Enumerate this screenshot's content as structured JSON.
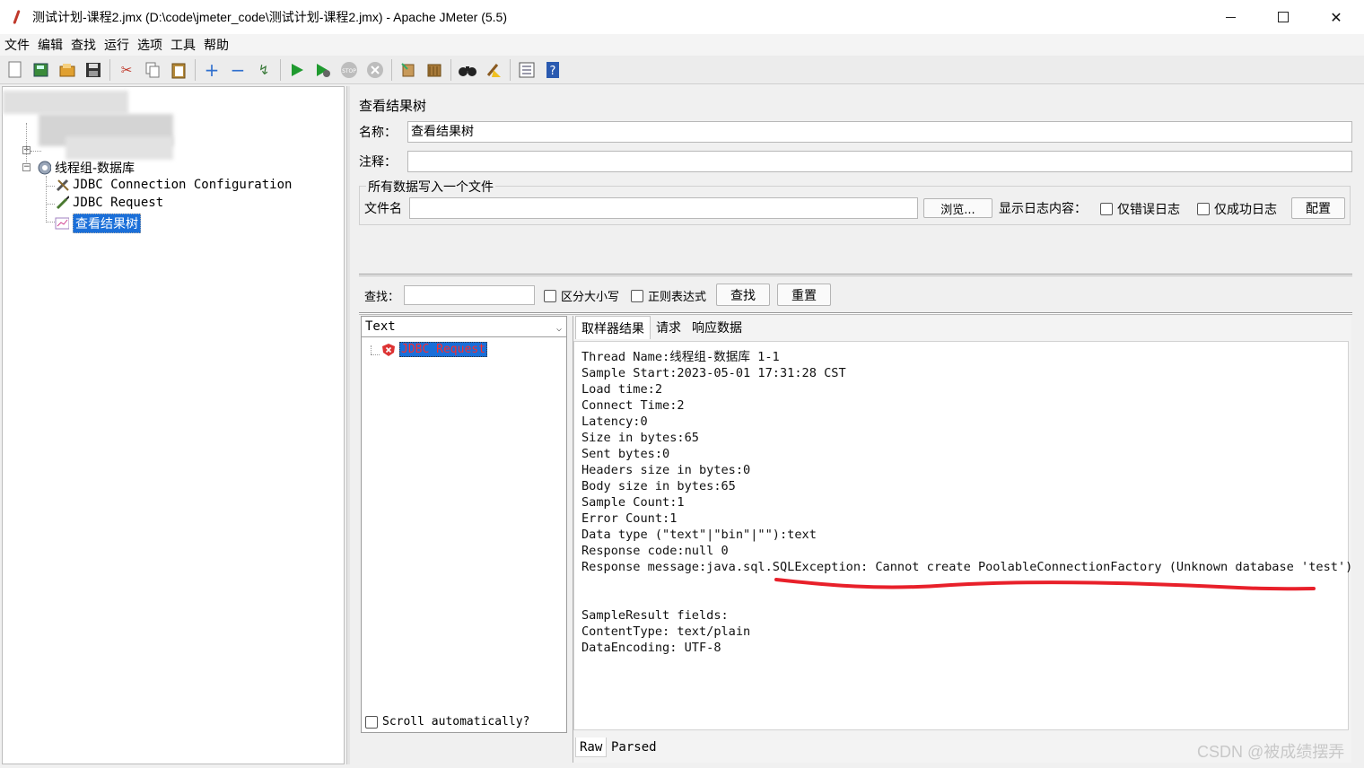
{
  "window": {
    "title": "测试计划-课程2.jmx (D:\\code\\jmeter_code\\测试计划-课程2.jmx) - Apache JMeter (5.5)"
  },
  "menu": [
    "文件",
    "编辑",
    "查找",
    "运行",
    "选项",
    "工具",
    "帮助"
  ],
  "toolbar": {
    "icons": [
      "new-icon",
      "templates-icon",
      "open-icon",
      "save-icon",
      "cut-icon",
      "copy-icon",
      "paste-icon",
      "expand-icon",
      "collapse-icon",
      "toggle-icon",
      "start-icon",
      "start-no-pauses-icon",
      "stop-icon",
      "shutdown-icon",
      "clear-icon",
      "clear-all-icon",
      "search-icon",
      "reset-search-icon",
      "function-helper-icon",
      "help-icon"
    ]
  },
  "tree": {
    "thread_group": "线程组-数据库",
    "items": [
      {
        "label": "JDBC Connection Configuration",
        "icon": "wrench-icon"
      },
      {
        "label": "JDBC Request",
        "icon": "pen-icon"
      },
      {
        "label": "查看结果树",
        "icon": "chart-icon",
        "selected": true
      }
    ]
  },
  "panel": {
    "heading": "查看结果树",
    "name_label": "名称：",
    "name_value": "查看结果树",
    "comment_label": "注释：",
    "comment_value": "",
    "file_group_title": "所有数据写入一个文件",
    "filename_label": "文件名",
    "filename_value": "",
    "browse_button": "浏览...",
    "log_display_label": "显示日志内容：",
    "errors_only": "仅错误日志",
    "success_only": "仅成功日志",
    "configure_button": "配置"
  },
  "search": {
    "label": "查找：",
    "value": "",
    "case_sensitive": "区分大小写",
    "regex": "正则表达式",
    "find_button": "查找",
    "reset_button": "重置"
  },
  "results": {
    "renderer": "Text",
    "samples": [
      {
        "label": "JDBC Request",
        "status": "error"
      }
    ],
    "scroll_auto": "Scroll automatically?"
  },
  "detail": {
    "tabs": [
      "取样器结果",
      "请求",
      "响应数据"
    ],
    "active_tab": "取样器结果",
    "lines": [
      "Thread Name:线程组-数据库 1-1",
      "Sample Start:2023-05-01 17:31:28 CST",
      "Load time:2",
      "Connect Time:2",
      "Latency:0",
      "Size in bytes:65",
      "Sent bytes:0",
      "Headers size in bytes:0",
      "Body size in bytes:65",
      "Sample Count:1",
      "Error Count:1",
      "Data type (\"text\"|\"bin\"|\"\"):text",
      "Response code:null 0",
      "Response message:java.sql.SQLException: Cannot create PoolableConnectionFactory (Unknown database 'test')",
      "",
      "",
      "SampleResult fields:",
      "ContentType: text/plain",
      "DataEncoding: UTF-8"
    ],
    "bottom_tabs": [
      "Raw",
      "Parsed"
    ]
  },
  "annotation_color": "#e8202a",
  "watermark": "CSDN @被成绩摆弄"
}
